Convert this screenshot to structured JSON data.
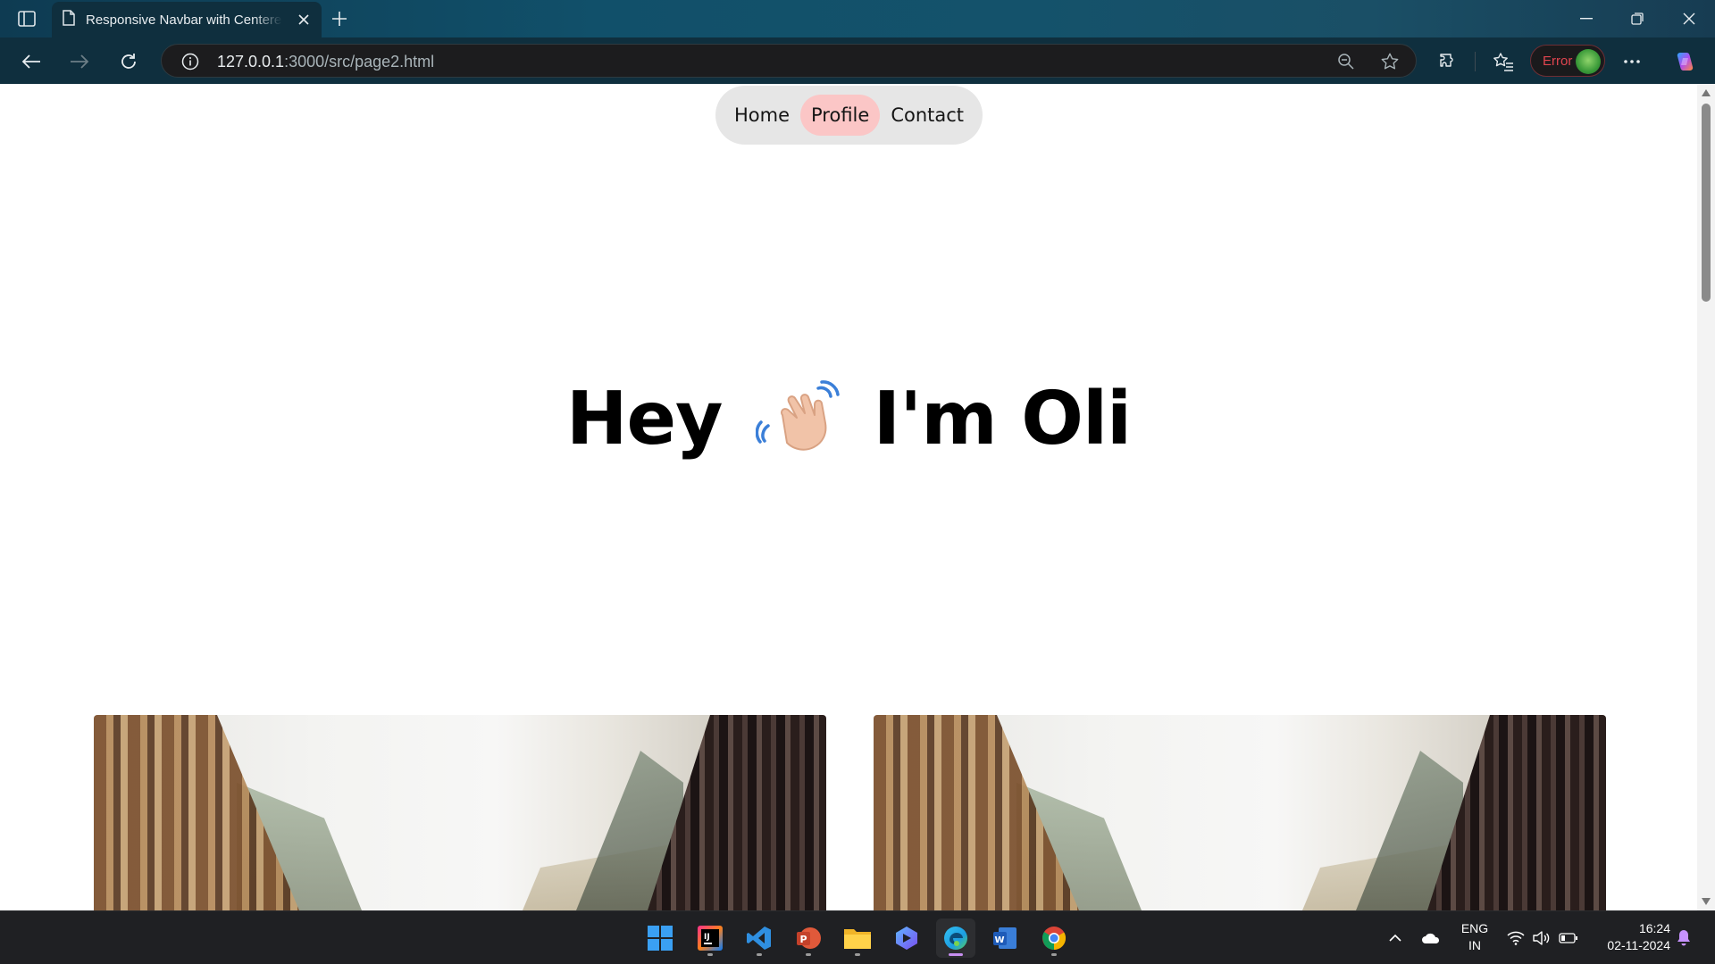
{
  "browser": {
    "tab_title": "Responsive Navbar with Centered",
    "url_host": "127.0.0.1",
    "url_rest": ":3000/src/page2.html",
    "profile_status": "Error"
  },
  "navbar": {
    "items": [
      {
        "label": "Home",
        "active": false
      },
      {
        "label": "Profile",
        "active": true
      },
      {
        "label": "Contact",
        "active": false
      }
    ]
  },
  "hero": {
    "before": "Hey",
    "after": "I'm Oli",
    "emoji_icon": "waving-hand-icon"
  },
  "taskbar": {
    "apps": [
      "windows-start",
      "intellij",
      "vscode",
      "powerpoint",
      "file-explorer",
      "copilot-app",
      "edge",
      "word",
      "chrome"
    ],
    "lang_line1": "ENG",
    "lang_line2": "IN",
    "time": "16:24",
    "date": "02-11-2024"
  },
  "colors": {
    "nav_bg": "#e6e6e6",
    "nav_active": "#fbc6c6",
    "chrome_bg": "#0f2f3e",
    "taskbar_bg": "#1f2023"
  }
}
